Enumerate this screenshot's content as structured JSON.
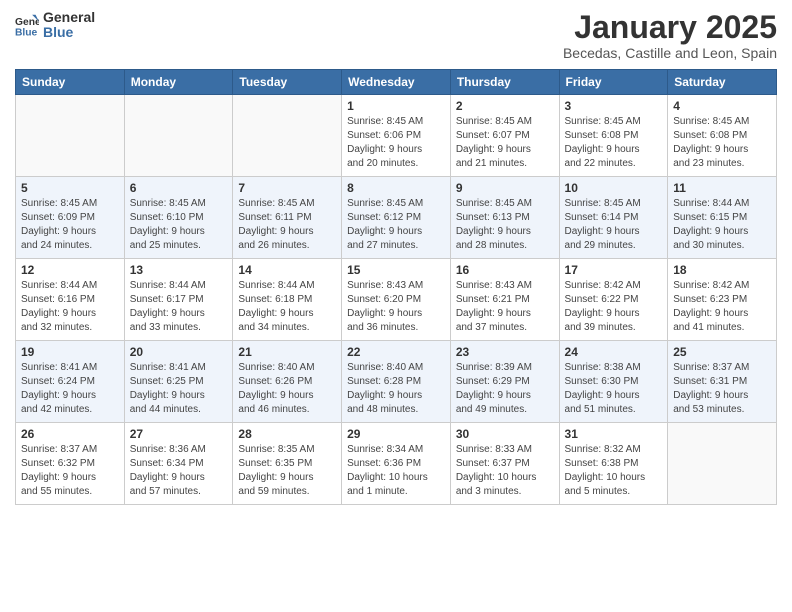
{
  "header": {
    "logo_general": "General",
    "logo_blue": "Blue",
    "month_year": "January 2025",
    "location": "Becedas, Castille and Leon, Spain"
  },
  "weekdays": [
    "Sunday",
    "Monday",
    "Tuesday",
    "Wednesday",
    "Thursday",
    "Friday",
    "Saturday"
  ],
  "weeks": [
    [
      {
        "day": "",
        "info": ""
      },
      {
        "day": "",
        "info": ""
      },
      {
        "day": "",
        "info": ""
      },
      {
        "day": "1",
        "info": "Sunrise: 8:45 AM\nSunset: 6:06 PM\nDaylight: 9 hours\nand 20 minutes."
      },
      {
        "day": "2",
        "info": "Sunrise: 8:45 AM\nSunset: 6:07 PM\nDaylight: 9 hours\nand 21 minutes."
      },
      {
        "day": "3",
        "info": "Sunrise: 8:45 AM\nSunset: 6:08 PM\nDaylight: 9 hours\nand 22 minutes."
      },
      {
        "day": "4",
        "info": "Sunrise: 8:45 AM\nSunset: 6:08 PM\nDaylight: 9 hours\nand 23 minutes."
      }
    ],
    [
      {
        "day": "5",
        "info": "Sunrise: 8:45 AM\nSunset: 6:09 PM\nDaylight: 9 hours\nand 24 minutes."
      },
      {
        "day": "6",
        "info": "Sunrise: 8:45 AM\nSunset: 6:10 PM\nDaylight: 9 hours\nand 25 minutes."
      },
      {
        "day": "7",
        "info": "Sunrise: 8:45 AM\nSunset: 6:11 PM\nDaylight: 9 hours\nand 26 minutes."
      },
      {
        "day": "8",
        "info": "Sunrise: 8:45 AM\nSunset: 6:12 PM\nDaylight: 9 hours\nand 27 minutes."
      },
      {
        "day": "9",
        "info": "Sunrise: 8:45 AM\nSunset: 6:13 PM\nDaylight: 9 hours\nand 28 minutes."
      },
      {
        "day": "10",
        "info": "Sunrise: 8:45 AM\nSunset: 6:14 PM\nDaylight: 9 hours\nand 29 minutes."
      },
      {
        "day": "11",
        "info": "Sunrise: 8:44 AM\nSunset: 6:15 PM\nDaylight: 9 hours\nand 30 minutes."
      }
    ],
    [
      {
        "day": "12",
        "info": "Sunrise: 8:44 AM\nSunset: 6:16 PM\nDaylight: 9 hours\nand 32 minutes."
      },
      {
        "day": "13",
        "info": "Sunrise: 8:44 AM\nSunset: 6:17 PM\nDaylight: 9 hours\nand 33 minutes."
      },
      {
        "day": "14",
        "info": "Sunrise: 8:44 AM\nSunset: 6:18 PM\nDaylight: 9 hours\nand 34 minutes."
      },
      {
        "day": "15",
        "info": "Sunrise: 8:43 AM\nSunset: 6:20 PM\nDaylight: 9 hours\nand 36 minutes."
      },
      {
        "day": "16",
        "info": "Sunrise: 8:43 AM\nSunset: 6:21 PM\nDaylight: 9 hours\nand 37 minutes."
      },
      {
        "day": "17",
        "info": "Sunrise: 8:42 AM\nSunset: 6:22 PM\nDaylight: 9 hours\nand 39 minutes."
      },
      {
        "day": "18",
        "info": "Sunrise: 8:42 AM\nSunset: 6:23 PM\nDaylight: 9 hours\nand 41 minutes."
      }
    ],
    [
      {
        "day": "19",
        "info": "Sunrise: 8:41 AM\nSunset: 6:24 PM\nDaylight: 9 hours\nand 42 minutes."
      },
      {
        "day": "20",
        "info": "Sunrise: 8:41 AM\nSunset: 6:25 PM\nDaylight: 9 hours\nand 44 minutes."
      },
      {
        "day": "21",
        "info": "Sunrise: 8:40 AM\nSunset: 6:26 PM\nDaylight: 9 hours\nand 46 minutes."
      },
      {
        "day": "22",
        "info": "Sunrise: 8:40 AM\nSunset: 6:28 PM\nDaylight: 9 hours\nand 48 minutes."
      },
      {
        "day": "23",
        "info": "Sunrise: 8:39 AM\nSunset: 6:29 PM\nDaylight: 9 hours\nand 49 minutes."
      },
      {
        "day": "24",
        "info": "Sunrise: 8:38 AM\nSunset: 6:30 PM\nDaylight: 9 hours\nand 51 minutes."
      },
      {
        "day": "25",
        "info": "Sunrise: 8:37 AM\nSunset: 6:31 PM\nDaylight: 9 hours\nand 53 minutes."
      }
    ],
    [
      {
        "day": "26",
        "info": "Sunrise: 8:37 AM\nSunset: 6:32 PM\nDaylight: 9 hours\nand 55 minutes."
      },
      {
        "day": "27",
        "info": "Sunrise: 8:36 AM\nSunset: 6:34 PM\nDaylight: 9 hours\nand 57 minutes."
      },
      {
        "day": "28",
        "info": "Sunrise: 8:35 AM\nSunset: 6:35 PM\nDaylight: 9 hours\nand 59 minutes."
      },
      {
        "day": "29",
        "info": "Sunrise: 8:34 AM\nSunset: 6:36 PM\nDaylight: 10 hours\nand 1 minute."
      },
      {
        "day": "30",
        "info": "Sunrise: 8:33 AM\nSunset: 6:37 PM\nDaylight: 10 hours\nand 3 minutes."
      },
      {
        "day": "31",
        "info": "Sunrise: 8:32 AM\nSunset: 6:38 PM\nDaylight: 10 hours\nand 5 minutes."
      },
      {
        "day": "",
        "info": ""
      }
    ]
  ]
}
